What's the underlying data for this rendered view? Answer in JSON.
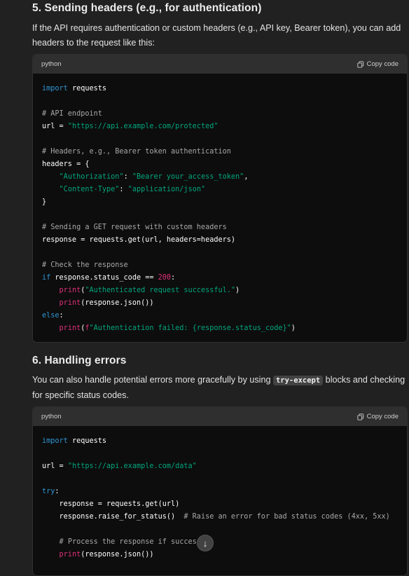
{
  "section5": {
    "heading": "5. Sending headers (e.g., for authentication)",
    "paragraph": "If the API requires authentication or custom headers (e.g., API key, Bearer token), you can add headers to the request like this:",
    "code": {
      "language": "python",
      "copy_label": "Copy code",
      "lines": [
        "import requests",
        "",
        "# API endpoint",
        "url = \"https://api.example.com/protected\"",
        "",
        "# Headers, e.g., Bearer token authentication",
        "headers = {",
        "    \"Authorization\": \"Bearer your_access_token\",",
        "    \"Content-Type\": \"application/json\"",
        "}",
        "",
        "# Sending a GET request with custom headers",
        "response = requests.get(url, headers=headers)",
        "",
        "# Check the response",
        "if response.status_code == 200:",
        "    print(\"Authenticated request successful.\")",
        "    print(response.json())",
        "else:",
        "    print(f\"Authentication failed: {response.status_code}\")"
      ]
    }
  },
  "section6": {
    "heading": "6. Handling errors",
    "paragraph_before": "You can also handle potential errors more gracefully by using ",
    "inline_code": "try-except",
    "paragraph_after": " blocks and checking for specific status codes.",
    "code": {
      "language": "python",
      "copy_label": "Copy code",
      "lines": [
        "import requests",
        "",
        "url = \"https://api.example.com/data\"",
        "",
        "try:",
        "    response = requests.get(url)",
        "    response.raise_for_status()  # Raise an error for bad status codes (4xx, 5xx)",
        "",
        "    # Process the response if successful",
        "    print(response.json())"
      ]
    }
  },
  "scroll_button_icon": "arrow-down-icon",
  "colors": {
    "background": "#212121",
    "code_background": "#0d0d0d",
    "keyword": "#2e95d3",
    "string": "#00a67d",
    "comment": "#a8a8a8",
    "builtin": "#df3079"
  }
}
